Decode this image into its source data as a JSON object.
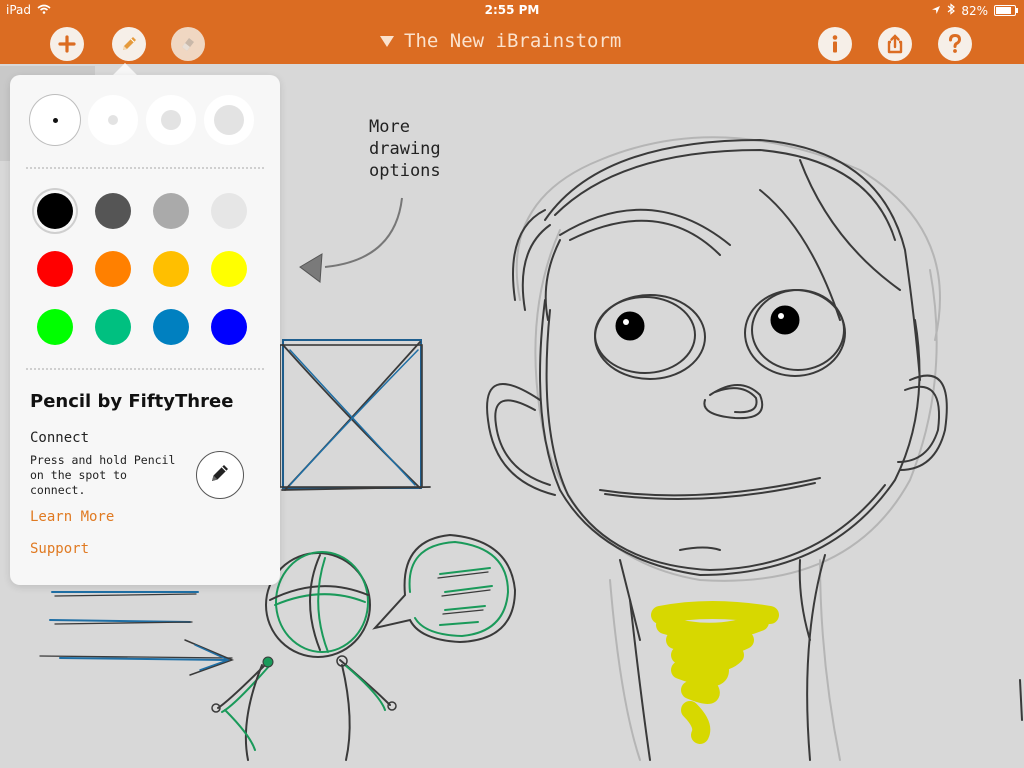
{
  "status_bar": {
    "device": "iPad",
    "time": "2:55 PM",
    "battery": "82%",
    "battery_level": 0.82
  },
  "toolbar": {
    "title": "The New iBrainstorm",
    "buttons": {
      "add": "plus-icon",
      "pencil": "pencil-icon",
      "eraser": "eraser-icon",
      "info": "info-icon",
      "share": "share-icon",
      "help": "question-icon"
    }
  },
  "colors": {
    "accent": "#db6c22",
    "link": "#e07a22",
    "palette": [
      "#000000",
      "#555555",
      "#aaaaaa",
      "#e6e6e6",
      "#ff0000",
      "#ff8000",
      "#ffbf00",
      "#ffff00",
      "#00ff00",
      "#00c080",
      "#0080c0",
      "#0000ff"
    ]
  },
  "popover": {
    "title": "Pencil by FiftyThree",
    "connect_heading": "Connect",
    "connect_description": "Press and hold Pencil on the spot to connect.",
    "learn_more": "Learn More",
    "support": "Support",
    "selected_color_index": 0,
    "selected_size_index": 0
  },
  "canvas": {
    "annotation": "More\ndrawing\noptions"
  }
}
